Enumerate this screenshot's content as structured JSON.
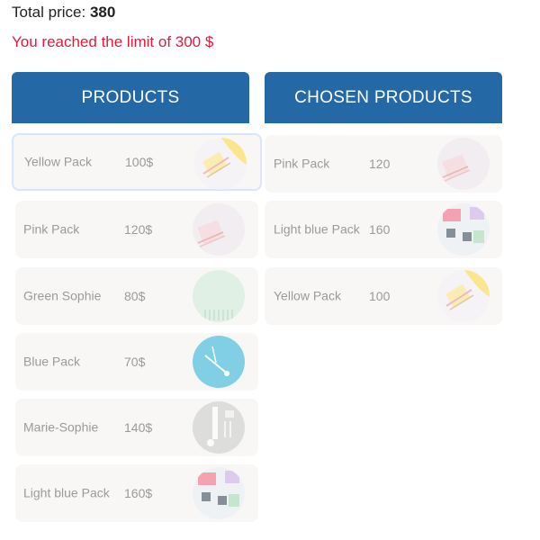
{
  "summary": {
    "total_label": "Total price:",
    "total_value": "380",
    "limit_message": "You reached the limit of 300 $"
  },
  "products": {
    "header": "PRODUCTS",
    "items": [
      {
        "name": "Yellow Pack",
        "price": "100$",
        "icon": "yellow-pack-image"
      },
      {
        "name": "Pink Pack",
        "price": "120$",
        "icon": "pink-pack-image"
      },
      {
        "name": "Green Sophie",
        "price": "80$",
        "icon": "green-sophie-image"
      },
      {
        "name": "Blue Pack",
        "price": "70$",
        "icon": "blue-pack-image"
      },
      {
        "name": "Marie-Sophie",
        "price": "140$",
        "icon": "marie-sophie-image"
      },
      {
        "name": "Light blue Pack",
        "price": "160$",
        "icon": "light-blue-pack-image"
      }
    ]
  },
  "chosen": {
    "header": "CHOSEN PRODUCTS",
    "items": [
      {
        "name": "Pink Pack",
        "price": "120",
        "icon": "pink-pack-image"
      },
      {
        "name": "Light blue Pack",
        "price": "160",
        "icon": "light-blue-pack-image"
      },
      {
        "name": "Yellow Pack",
        "price": "100",
        "icon": "yellow-pack-image"
      }
    ]
  },
  "colors": {
    "header_bg": "#2468a6",
    "limit_text": "#e8173a",
    "card_bg": "#f8f7f6"
  }
}
